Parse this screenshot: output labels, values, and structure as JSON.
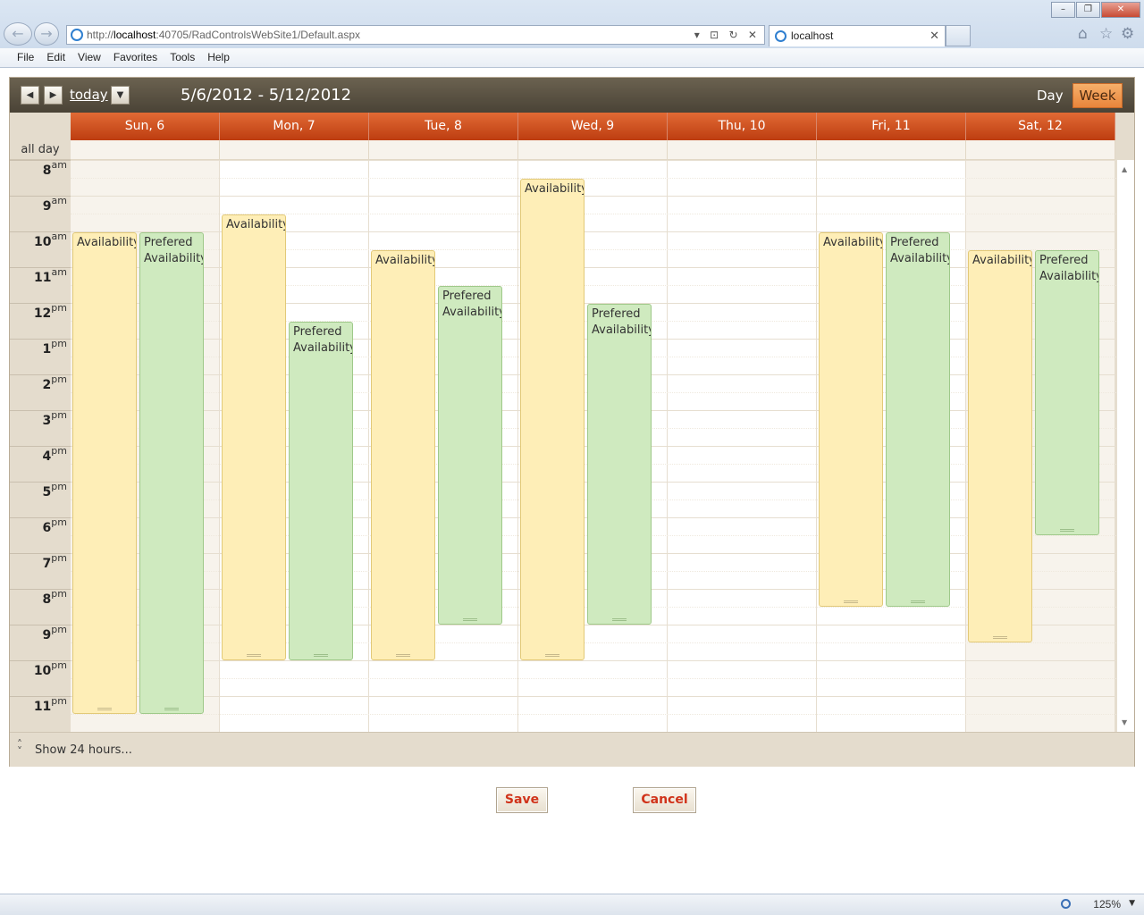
{
  "browser": {
    "url_prefix": "http://",
    "url_host": "localhost",
    "url_rest": ":40705/RadControlsWebSite1/Default.aspx",
    "tab_title": "localhost",
    "menu": [
      "File",
      "Edit",
      "View",
      "Favorites",
      "Tools",
      "Help"
    ],
    "zoom": "125%"
  },
  "scheduler": {
    "today_label": "today",
    "date_range": "5/6/2012 - 5/12/2012",
    "view_day": "Day",
    "view_week": "Week",
    "allday_label": "all day",
    "show_24": "Show 24 hours...",
    "days": [
      {
        "label": "Sun, 6",
        "weekend": true
      },
      {
        "label": "Mon, 7",
        "weekend": false
      },
      {
        "label": "Tue, 8",
        "weekend": false
      },
      {
        "label": "Wed, 9",
        "weekend": false
      },
      {
        "label": "Thu, 10",
        "weekend": false
      },
      {
        "label": "Fri, 11",
        "weekend": false
      },
      {
        "label": "Sat, 12",
        "weekend": true
      }
    ],
    "hours": [
      {
        "h": "8",
        "ampm": "am"
      },
      {
        "h": "9",
        "ampm": "am"
      },
      {
        "h": "10",
        "ampm": "am"
      },
      {
        "h": "11",
        "ampm": "am"
      },
      {
        "h": "12",
        "ampm": "pm"
      },
      {
        "h": "1",
        "ampm": "pm"
      },
      {
        "h": "2",
        "ampm": "pm"
      },
      {
        "h": "3",
        "ampm": "pm"
      },
      {
        "h": "4",
        "ampm": "pm"
      },
      {
        "h": "5",
        "ampm": "pm"
      },
      {
        "h": "6",
        "ampm": "pm"
      },
      {
        "h": "7",
        "ampm": "pm"
      },
      {
        "h": "8",
        "ampm": "pm"
      },
      {
        "h": "9",
        "ampm": "pm"
      },
      {
        "h": "10",
        "ampm": "pm"
      },
      {
        "h": "11",
        "ampm": "pm"
      }
    ],
    "appointments": [
      {
        "day": 0,
        "kind": "avail",
        "subject": "Availability",
        "start": 10,
        "end": 23.5
      },
      {
        "day": 0,
        "kind": "pref",
        "subject": "Prefered Availability",
        "start": 10,
        "end": 23.5
      },
      {
        "day": 1,
        "kind": "avail",
        "subject": "Availability",
        "start": 9.5,
        "end": 22
      },
      {
        "day": 1,
        "kind": "pref",
        "subject": "Prefered Availability",
        "start": 12.5,
        "end": 22
      },
      {
        "day": 2,
        "kind": "avail",
        "subject": "Availability",
        "start": 10.5,
        "end": 22
      },
      {
        "day": 2,
        "kind": "pref",
        "subject": "Prefered Availability",
        "start": 11.5,
        "end": 21
      },
      {
        "day": 3,
        "kind": "avail",
        "subject": "Availability",
        "start": 8.5,
        "end": 22
      },
      {
        "day": 3,
        "kind": "pref",
        "subject": "Prefered Availability",
        "start": 12,
        "end": 21
      },
      {
        "day": 5,
        "kind": "avail",
        "subject": "Availability",
        "start": 10,
        "end": 20.5
      },
      {
        "day": 5,
        "kind": "pref",
        "subject": "Prefered Availability",
        "start": 10,
        "end": 20.5
      },
      {
        "day": 6,
        "kind": "avail",
        "subject": "Availability",
        "start": 10.5,
        "end": 21.5
      },
      {
        "day": 6,
        "kind": "pref",
        "subject": "Prefered Availability",
        "start": 10.5,
        "end": 18.5
      }
    ]
  },
  "actions": {
    "save": "Save",
    "cancel": "Cancel"
  },
  "icons": {
    "back": "arrow-left-icon",
    "forward": "arrow-right-icon",
    "ie": "ie-logo-icon",
    "home": "home-icon",
    "favorites": "star-icon",
    "tools": "gear-icon",
    "prev": "triangle-left-icon",
    "next": "triangle-right-icon",
    "calendar": "dropdown-icon"
  },
  "colors": {
    "day_header": "#c94515",
    "availability": "#feeeb7",
    "prefered": "#cfeabf",
    "week_active": "#ef9a50",
    "action_text": "#d0331a"
  }
}
